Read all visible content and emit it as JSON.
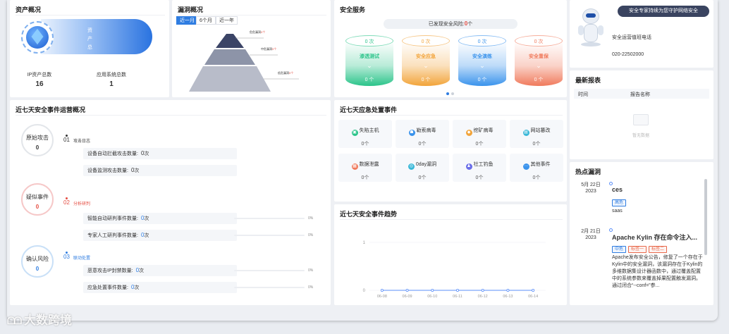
{
  "asset_overview": {
    "title": "资产概况",
    "banner_text": "资产总数",
    "ip_label": "IP资产总数",
    "ip_value": "16",
    "app_label": "应用系统总数",
    "app_value": "1"
  },
  "vuln_overview": {
    "title": "漏洞概况",
    "tabs": [
      "近一月",
      "6个月",
      "近一年"
    ],
    "levels": [
      {
        "label": "危危漏洞",
        "value": "0个"
      },
      {
        "label": "中危漏洞",
        "value": "0个"
      },
      {
        "label": "低危漏洞",
        "value": "0个"
      }
    ]
  },
  "security_service": {
    "title": "安全服务",
    "risk_label": "已发现安全风险:",
    "risk_value": "0",
    "risk_unit": "个",
    "items": [
      {
        "top": "0 次",
        "name": "渗透测试",
        "bottom": "0 个",
        "color": "#2bc48a"
      },
      {
        "top": "0 次",
        "name": "安全应急",
        "bottom": "0 个",
        "color": "#f2a43a"
      },
      {
        "top": "0 次",
        "name": "安全演练",
        "bottom": "0 个",
        "color": "#3a93ec"
      },
      {
        "top": "0 次",
        "name": "安全重保",
        "bottom": "0 个",
        "color": "#f07a5c"
      }
    ]
  },
  "expert": {
    "bubble": "安全专家持续为您守护网络安全",
    "hotline_label": "安全运营值班电话",
    "hotline": "020-22502000"
  },
  "reports": {
    "title": "最新报表",
    "col_time": "时间",
    "col_name": "报告名称",
    "empty": "暂无数据"
  },
  "weekly_events": {
    "title": "近七天安全事件运营概况",
    "stages": [
      {
        "num": "01",
        "label": "攻击日志",
        "circle": "原始攻击",
        "value": "0"
      },
      {
        "num": "02",
        "label": "分析研判",
        "circle": "疑似事件",
        "value": "0"
      },
      {
        "num": "03",
        "label": "联动处置",
        "circle": "确认风险",
        "value": "0"
      }
    ],
    "rows": [
      {
        "label": "设备自动拦截攻击数量:",
        "value": "0",
        "unit": "次"
      },
      {
        "label": "设备监测攻击数量:",
        "value": "0",
        "unit": "次"
      },
      {
        "label": "智能自动研判事件数量:",
        "value": "0",
        "unit": "次",
        "pct": "0%"
      },
      {
        "label": "专家人工研判事件数量:",
        "value": "0",
        "unit": "次",
        "pct": "0%"
      },
      {
        "label": "恶意攻击IP封禁数量:",
        "value": "0",
        "unit": "次",
        "pct": "0%"
      },
      {
        "label": "应急处置事件数量:",
        "value": "0",
        "unit": "次",
        "pct": "0%"
      }
    ]
  },
  "emergency": {
    "title": "近七天应急处置事件",
    "items": [
      {
        "name": "失陷主机",
        "value": "0个",
        "color": "#2bc48a",
        "glyph": "▣"
      },
      {
        "name": "勒索病毒",
        "value": "0个",
        "color": "#3a93ec",
        "glyph": "☗"
      },
      {
        "name": "挖矿病毒",
        "value": "0个",
        "color": "#f2a43a",
        "glyph": "◆"
      },
      {
        "name": "网站篡改",
        "value": "0个",
        "color": "#3ab8d8",
        "glyph": "▤"
      },
      {
        "name": "数据泄露",
        "value": "0个",
        "color": "#f07a5c",
        "glyph": "▦"
      },
      {
        "name": "0day漏洞",
        "value": "0个",
        "color": "#3ab8d8",
        "glyph": "◎"
      },
      {
        "name": "社工钓鱼",
        "value": "0个",
        "color": "#6a6ee8",
        "glyph": "♟"
      },
      {
        "name": "其他事件",
        "value": "0个",
        "color": "#3a93ec",
        "glyph": "⋯"
      }
    ]
  },
  "trend": {
    "title": "近七天安全事件趋势"
  },
  "chart_data": {
    "type": "line",
    "categories": [
      "06-08",
      "06-09",
      "06-10",
      "06-11",
      "06-12",
      "06-13",
      "06-14"
    ],
    "series": [
      {
        "values": [
          0,
          0,
          0,
          0,
          0,
          0,
          0
        ]
      }
    ],
    "y_ticks": [
      "0",
      "1"
    ],
    "ylim": [
      0,
      1
    ],
    "color": "#5b8ff9"
  },
  "hot_vulns": {
    "title": "热点漏洞",
    "items": [
      {
        "date": "5月 22日",
        "year": "2023",
        "title": "ces",
        "tags": [
          {
            "text": "高危",
            "color": "#2f7de1"
          }
        ],
        "desc": "saas"
      },
      {
        "date": "2月 21日",
        "year": "2023",
        "title": "Apache Kylin 存在命令注入...",
        "tags": [
          {
            "text": "中危",
            "color": "#2f7de1"
          },
          {
            "text": "标签一",
            "color": "#e8684a"
          },
          {
            "text": "标签二",
            "color": "#e8684a"
          }
        ],
        "desc": "Apache发布安全公告，修复了一个存在于Kylin中的安全漏洞，该漏洞存在于Kylin的多维数据集设计器函数中，通过覆盖配置中的系统参数来覆盖掉果配置触发漏洞。通过闭合“--conf=”参..."
      }
    ]
  },
  "watermark": "大数跨境"
}
